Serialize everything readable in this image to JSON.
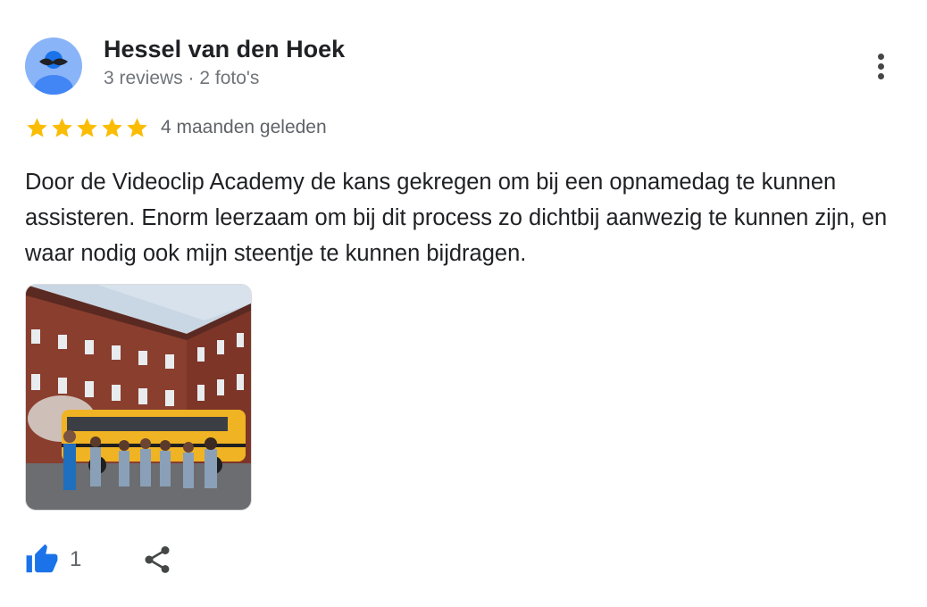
{
  "author": {
    "name": "Hessel van den Hoek",
    "meta": "3 reviews · 2 foto's"
  },
  "review": {
    "rating": 5,
    "max_rating": 5,
    "time": "4 maanden geleden",
    "text": "Door de Videoclip Academy de kans gekregen om bij een opnamedag te kunnen assisteren. Enorm leerzaam om bij dit process zo dichtbij aanwezig te kunnen zijn, en waar nodig ook mijn steentje te kunnen bijdragen."
  },
  "actions": {
    "like_count": "1"
  },
  "colors": {
    "star": "#fbbc04",
    "like": "#1a73e8",
    "avatar_bg": "#8ab4f8",
    "avatar_body": "#4285f4"
  },
  "icons": [
    "more-vert-icon",
    "star-icon",
    "thumb-up-icon",
    "share-icon"
  ]
}
